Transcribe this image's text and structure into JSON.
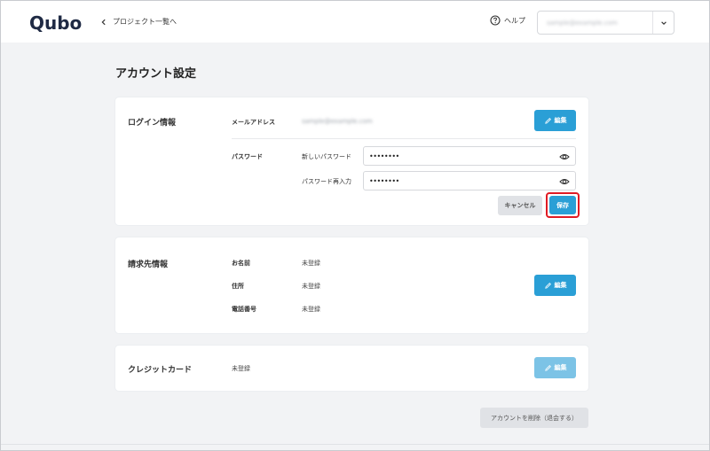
{
  "header": {
    "logo": "Qubo",
    "back_label": "プロジェクト一覧へ",
    "help_label": "ヘルプ",
    "user_email": "sample@example.com"
  },
  "page_title": "アカウント設定",
  "login": {
    "title": "ログイン情報",
    "email_label": "メールアドレス",
    "email_value": "sample@example.com",
    "edit_label": "編集",
    "password_label": "パスワード",
    "new_password_label": "新しいパスワード",
    "new_password_value": "••••••••",
    "confirm_password_label": "パスワード再入力",
    "confirm_password_value": "••••••••",
    "cancel_label": "キャンセル",
    "save_label": "保存"
  },
  "billing": {
    "title": "請求先情報",
    "name_label": "お名前",
    "name_value": "未登録",
    "address_label": "住所",
    "address_value": "未登録",
    "phone_label": "電話番号",
    "phone_value": "未登録",
    "edit_label": "編集"
  },
  "card": {
    "title": "クレジットカード",
    "value": "未登録",
    "edit_label": "編集"
  },
  "delete_label": "アカウントを削除（退会する）",
  "colors": {
    "accent": "#2a9fd6",
    "highlight": "#e01b24"
  }
}
